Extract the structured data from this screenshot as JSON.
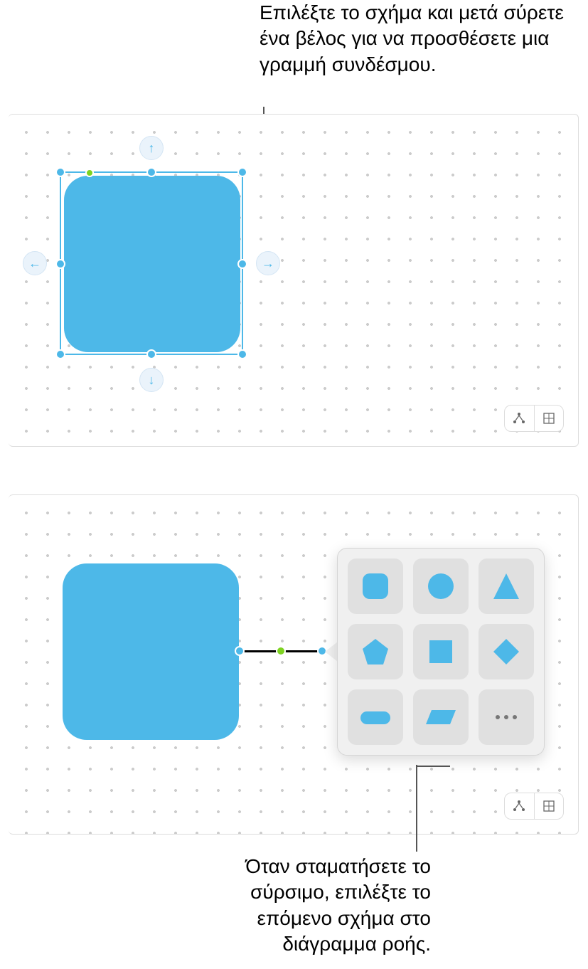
{
  "captions": {
    "top": "Επιλέξτε το σχήμα και μετά σύρετε ένα βέλος για να προσθέσετε μια γραμμή συνδέσμου.",
    "bottom": "Όταν σταματήσετε το σύρσιμο, επιλέξτε το επόμενο σχήμα στο διάγραμμα ροής."
  },
  "colors": {
    "shape": "#4db8e8",
    "rotation_handle": "#7ed321"
  },
  "arrows": {
    "up": "↑",
    "down": "↓",
    "left": "←",
    "right": "→"
  },
  "shape_picker_icons": [
    "rounded-square",
    "circle",
    "triangle",
    "pentagon",
    "square",
    "diamond",
    "pill",
    "parallelogram",
    "more"
  ],
  "toolbar_icons": [
    "connection-mode",
    "grid-mode"
  ]
}
